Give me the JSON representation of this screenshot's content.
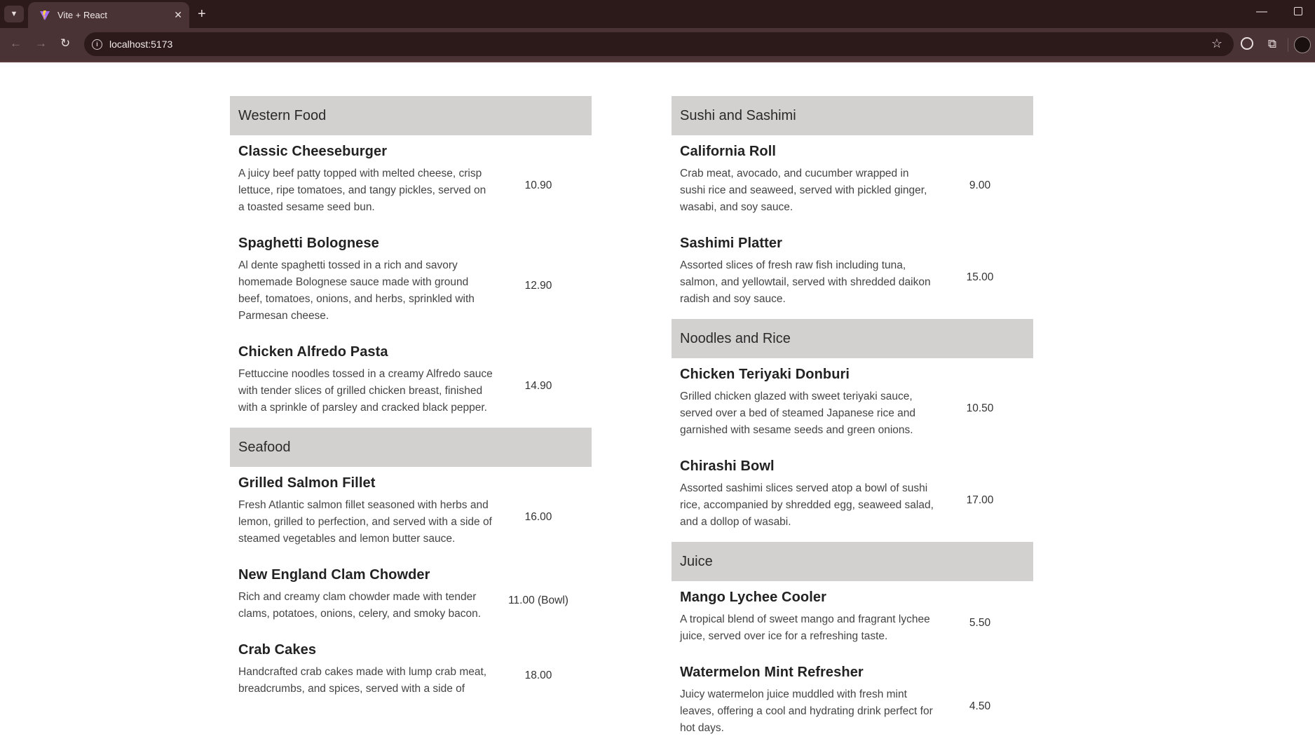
{
  "browser": {
    "tab_title": "Vite + React",
    "new_tab_symbol": "+",
    "close_symbol": "✕",
    "url": "localhost:5173"
  },
  "menu": {
    "left": [
      {
        "category": "Western Food",
        "items": [
          {
            "name": "Classic Cheeseburger",
            "description": "A juicy beef patty topped with melted cheese, crisp lettuce, ripe tomatoes, and tangy pickles, served on a toasted sesame seed bun.",
            "price": "10.90"
          },
          {
            "name": "Spaghetti Bolognese",
            "description": "Al dente spaghetti tossed in a rich and savory homemade Bolognese sauce made with ground beef, tomatoes, onions, and herbs, sprinkled with Parmesan cheese.",
            "price": "12.90"
          },
          {
            "name": "Chicken Alfredo Pasta",
            "description": "Fettuccine noodles tossed in a creamy Alfredo sauce with tender slices of grilled chicken breast, finished with a sprinkle of parsley and cracked black pepper.",
            "price": "14.90"
          }
        ]
      },
      {
        "category": "Seafood",
        "items": [
          {
            "name": "Grilled Salmon Fillet",
            "description": "Fresh Atlantic salmon fillet seasoned with herbs and lemon, grilled to perfection, and served with a side of steamed vegetables and lemon butter sauce.",
            "price": "16.00"
          },
          {
            "name": "New England Clam Chowder",
            "description": "Rich and creamy clam chowder made with tender clams, potatoes, onions, celery, and smoky bacon.",
            "price": "11.00 (Bowl)"
          },
          {
            "name": "Crab Cakes",
            "description": "Handcrafted crab cakes made with lump crab meat, breadcrumbs, and spices, served with a side of",
            "price": "18.00"
          }
        ]
      }
    ],
    "right": [
      {
        "category": "Sushi and Sashimi",
        "items": [
          {
            "name": "California Roll",
            "description": "Crab meat, avocado, and cucumber wrapped in sushi rice and seaweed, served with pickled ginger, wasabi, and soy sauce.",
            "price": "9.00"
          },
          {
            "name": "Sashimi Platter",
            "description": "Assorted slices of fresh raw fish including tuna, salmon, and yellowtail, served with shredded daikon radish and soy sauce.",
            "price": "15.00"
          }
        ]
      },
      {
        "category": "Noodles and Rice",
        "items": [
          {
            "name": "Chicken Teriyaki Donburi",
            "description": "Grilled chicken glazed with sweet teriyaki sauce, served over a bed of steamed Japanese rice and garnished with sesame seeds and green onions.",
            "price": "10.50"
          },
          {
            "name": "Chirashi Bowl",
            "description": "Assorted sashimi slices served atop a bowl of sushi rice, accompanied by shredded egg, seaweed salad, and a dollop of wasabi.",
            "price": "17.00"
          }
        ]
      },
      {
        "category": "Juice",
        "items": [
          {
            "name": "Mango Lychee Cooler",
            "description": "A tropical blend of sweet mango and fragrant lychee juice, served over ice for a refreshing taste.",
            "price": "5.50"
          },
          {
            "name": "Watermelon Mint Refresher",
            "description": "Juicy watermelon juice muddled with fresh mint leaves, offering a cool and hydrating drink perfect for hot days.",
            "price": "4.50"
          }
        ]
      }
    ]
  }
}
